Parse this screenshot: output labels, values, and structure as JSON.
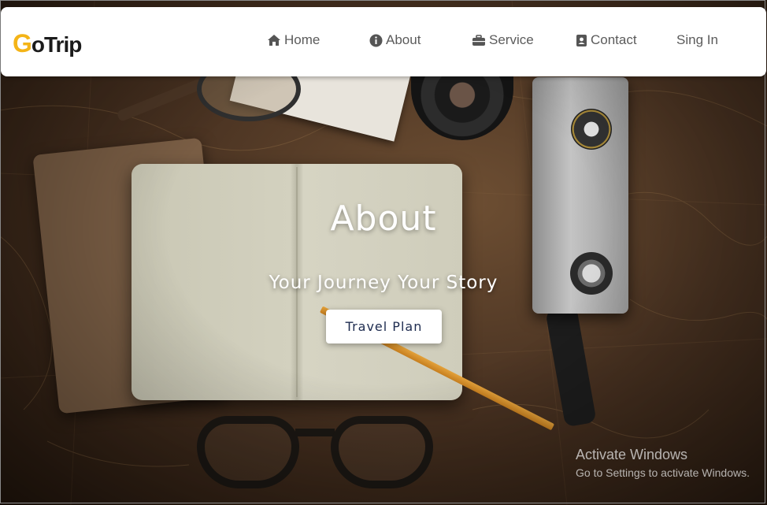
{
  "brand": {
    "logo_initial": "G",
    "logo_rest": "oTrip",
    "accent": "#f4b417"
  },
  "nav": {
    "items": [
      {
        "label": "Home",
        "icon": "home-icon"
      },
      {
        "label": "About",
        "icon": "info-icon"
      },
      {
        "label": "Service",
        "icon": "briefcase-icon"
      },
      {
        "label": "Contact",
        "icon": "contact-card-icon"
      }
    ],
    "signin_label": "Sing In"
  },
  "hero": {
    "title": "About",
    "subtitle": "Your Journey Your Story",
    "cta_label": "Travel Plan"
  },
  "watermark": {
    "title": "Activate Windows",
    "subtitle": "Go to Settings to activate Windows."
  }
}
